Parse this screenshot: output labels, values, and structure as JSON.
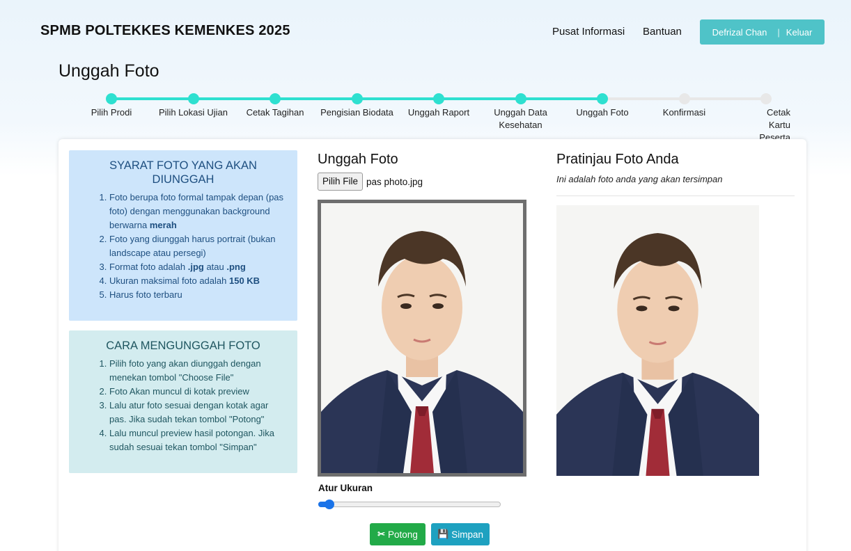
{
  "header": {
    "brand": "SPMB POLTEKKES KEMENKES 2025",
    "nav": [
      "Pusat Informasi",
      "Bantuan"
    ],
    "user_name": "Defrizal Chan",
    "logout": "Keluar",
    "accent_color": "#4fc3c8"
  },
  "page_title": "Unggah Foto",
  "steps": [
    {
      "label": "Pilih Prodi",
      "done": true
    },
    {
      "label": "Pilih Lokasi Ujian",
      "done": true
    },
    {
      "label": "Cetak Tagihan",
      "done": true
    },
    {
      "label": "Pengisian Biodata",
      "done": true
    },
    {
      "label": "Unggah Raport",
      "done": true
    },
    {
      "label": "Unggah Data Kesehatan",
      "done": true
    },
    {
      "label": "Unggah Foto",
      "done": true
    },
    {
      "label": "Konfirmasi",
      "done": false
    },
    {
      "label": "Cetak Kartu Peserta",
      "done": false
    }
  ],
  "requirements": {
    "title": "SYARAT FOTO YANG AKAN DIUNGGAH",
    "items": [
      [
        "Foto berupa foto formal tampak depan (pas foto) dengan menggunakan background berwarna ",
        "merah",
        ""
      ],
      [
        "Foto yang diunggah harus portrait (bukan landscape atau persegi)",
        "",
        ""
      ],
      [
        "Format foto adalah ",
        ".jpg",
        " atau ",
        ".png"
      ],
      [
        "Ukuran maksimal foto adalah ",
        "150 KB",
        ""
      ],
      [
        "Harus foto terbaru",
        "",
        ""
      ]
    ]
  },
  "howto": {
    "title": "CARA MENGUNGGAH FOTO",
    "items": [
      "Pilih foto yang akan diunggah dengan menekan tombol \"Choose File\"",
      "Foto Akan muncul di kotak preview",
      "Lalu atur foto sesuai dengan kotak agar pas. Jika sudah tekan tombol \"Potong\"",
      "Lalu muncul preview hasil potongan. Jika sudah sesuai tekan tombol \"Simpan\""
    ]
  },
  "upload": {
    "title": "Unggah Foto",
    "file_button": "Pilih File",
    "file_name": "pas photo.jpg",
    "size_label": "Atur Ukuran",
    "size_value": 0.06,
    "crop_button": "Potong",
    "save_button": "Simpan"
  },
  "preview": {
    "title": "Pratinjau Foto Anda",
    "subtitle": "Ini adalah foto anda yang akan tersimpan"
  },
  "colors": {
    "step_done": "#2ee0d0",
    "step_todo": "#e8e8e8",
    "crop_green": "#22aa48",
    "save_teal": "#1ea1c0"
  }
}
